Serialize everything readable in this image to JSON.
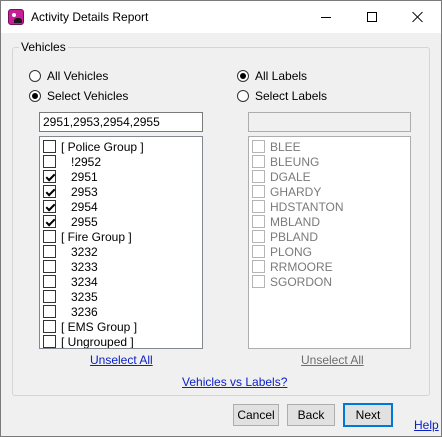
{
  "window": {
    "title": "Activity Details Report"
  },
  "group": {
    "label": "Vehicles"
  },
  "vehicles": {
    "all_label": "All Vehicles",
    "select_label": "Select Vehicles",
    "selected_mode": "select",
    "filter_value": "2951,2953,2954,2955",
    "items": [
      {
        "label": "[ Police Group ]",
        "checked": false,
        "indent": false
      },
      {
        "label": "!2952",
        "checked": false,
        "indent": true
      },
      {
        "label": "2951",
        "checked": true,
        "indent": true
      },
      {
        "label": "2953",
        "checked": true,
        "indent": true
      },
      {
        "label": "2954",
        "checked": true,
        "indent": true
      },
      {
        "label": "2955",
        "checked": true,
        "indent": true
      },
      {
        "label": "[ Fire Group ]",
        "checked": false,
        "indent": false
      },
      {
        "label": "3232",
        "checked": false,
        "indent": true
      },
      {
        "label": "3233",
        "checked": false,
        "indent": true
      },
      {
        "label": "3234",
        "checked": false,
        "indent": true
      },
      {
        "label": "3235",
        "checked": false,
        "indent": true
      },
      {
        "label": "3236",
        "checked": false,
        "indent": true
      },
      {
        "label": "[ EMS Group ]",
        "checked": false,
        "indent": false
      },
      {
        "label": "[ Ungrouped ]",
        "checked": false,
        "indent": false
      }
    ],
    "unselect_all": "Unselect All"
  },
  "labels": {
    "all_label": "All Labels",
    "select_label": "Select Labels",
    "selected_mode": "all",
    "filter_value": "",
    "items": [
      "BLEE",
      "BLEUNG",
      "DGALE",
      "GHARDY",
      "HDSTANTON",
      "MBLAND",
      "PBLAND",
      "PLONG",
      "RRMOORE",
      "SGORDON"
    ],
    "unselect_all": "Unselect All"
  },
  "vs_link": "Vehicles vs Labels?",
  "footer": {
    "cancel": "Cancel",
    "back": "Back",
    "next": "Next",
    "help": "Help"
  }
}
